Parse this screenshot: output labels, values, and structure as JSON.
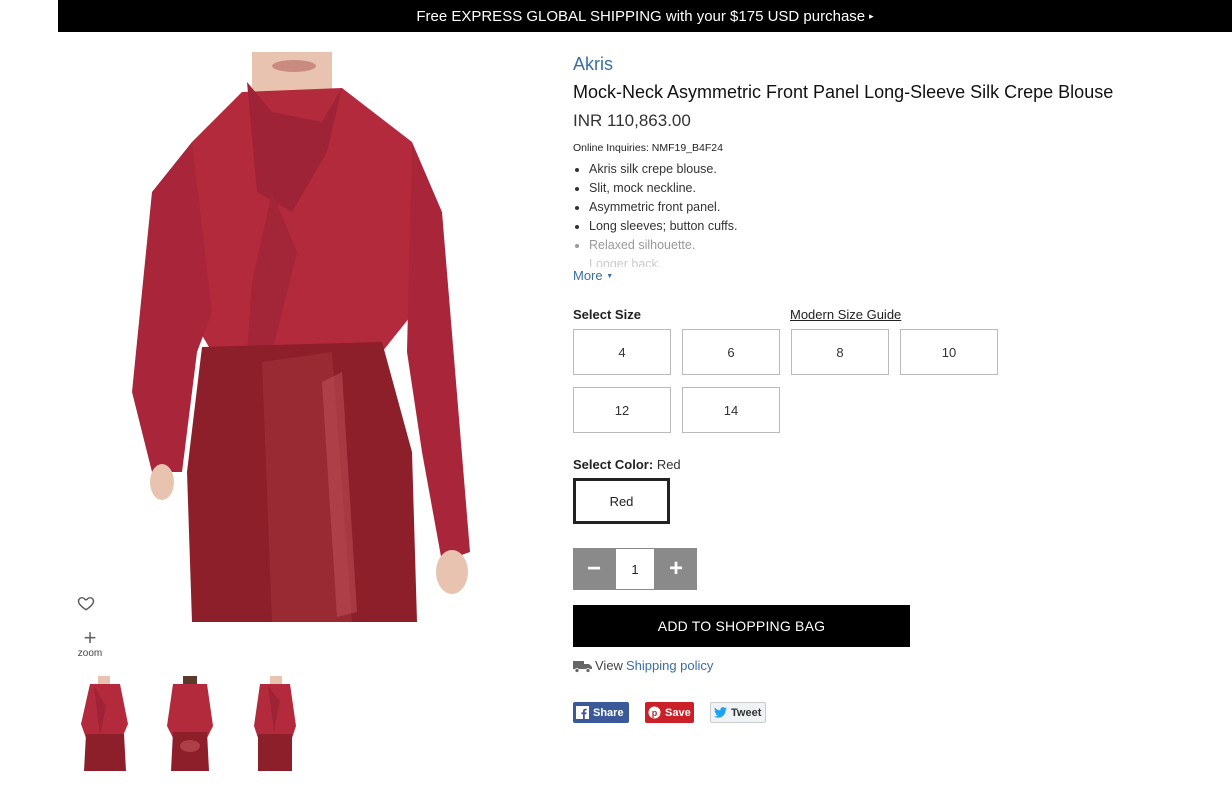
{
  "promo": {
    "text": "Free EXPRESS GLOBAL SHIPPING with your $175 USD purchase",
    "caret": "▸"
  },
  "gallery": {
    "zoom_label": "zoom",
    "thumbnails": [
      "thumbnail-front",
      "thumbnail-back",
      "thumbnail-side"
    ]
  },
  "product": {
    "brand": "Akris",
    "title": "Mock-Neck Asymmetric Front Panel Long-Sleeve Silk Crepe Blouse",
    "price": "INR 110,863.00",
    "inquiries": "Online Inquiries: NMF19_B4F24",
    "bullets": [
      "Akris silk crepe blouse.",
      "Slit, mock neckline.",
      "Asymmetric front panel.",
      "Long sleeves; button cuffs.",
      "Relaxed silhouette.",
      "Longer back."
    ],
    "more_label": "More"
  },
  "size": {
    "heading": "Select Size",
    "guide_label": "Modern Size Guide",
    "options": [
      "4",
      "6",
      "8",
      "10",
      "12",
      "14"
    ]
  },
  "color": {
    "heading": "Select Color:",
    "selected": "Red",
    "option": "Red",
    "swatch": "#b22a3c"
  },
  "quantity": {
    "minus": "−",
    "value": "1",
    "plus": "+"
  },
  "cart": {
    "add_label": "ADD TO SHOPPING BAG"
  },
  "shipping": {
    "prefix": "View",
    "link": "Shipping policy"
  },
  "share": {
    "facebook": "Share",
    "pinterest": "Save",
    "twitter": "Tweet"
  },
  "colors": {
    "accent_link": "#3a6ea5",
    "promo_bg": "#000000",
    "facebook": "#3b5998",
    "pinterest": "#cb2027"
  }
}
